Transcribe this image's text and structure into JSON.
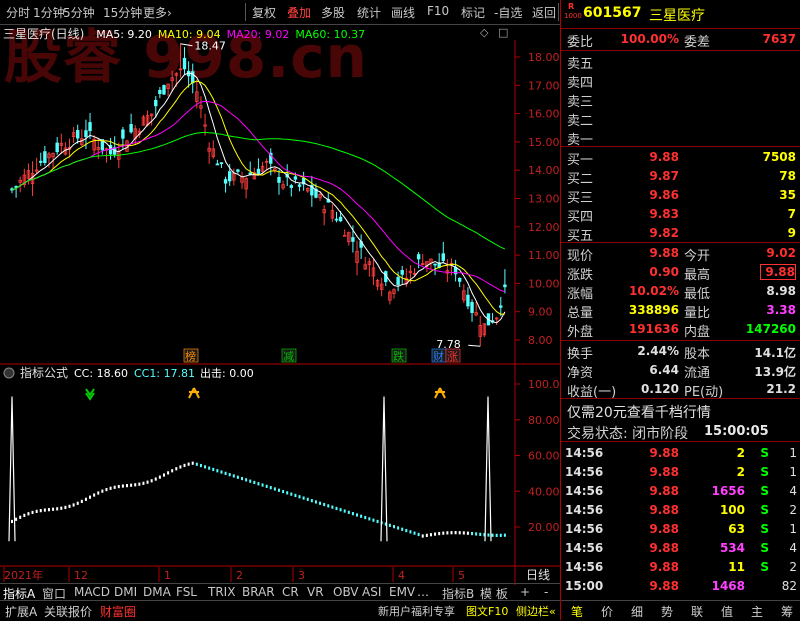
{
  "toolbar": {
    "items": [
      "分时",
      "1分钟",
      "5分钟",
      "15分钟",
      "更多›",
      "复权",
      "叠加",
      "多股",
      "统计",
      "画线",
      "F10",
      "标记",
      "-自选",
      "返回"
    ],
    "active_index": 6
  },
  "watermark": "股睿 998.cn",
  "main_chart": {
    "stock_title": "三星医疗(日线)",
    "ma_legend": [
      {
        "label": "MA5: 9.20",
        "color": "#ffffff"
      },
      {
        "label": "MA10: 9.04",
        "color": "#ffff00"
      },
      {
        "label": "MA20: 9.02",
        "color": "#ff00ff"
      },
      {
        "label": "MA60: 10.37",
        "color": "#00ff00"
      }
    ],
    "high_label": "18.47",
    "low_label": "7.78",
    "y_ticks": [
      "18.00",
      "17.00",
      "16.00",
      "15.00",
      "14.00",
      "13.00",
      "12.00",
      "11.00",
      "10.00",
      "9.00",
      "8.00"
    ],
    "badges": [
      {
        "text": "榜",
        "color": "#ff8c00"
      },
      {
        "text": "减",
        "color": "#00c000"
      },
      {
        "text": "跌",
        "color": "#00c000"
      },
      {
        "text": "财",
        "color": "#2080ff"
      },
      {
        "text": "涨",
        "color": "#ff3030"
      }
    ]
  },
  "indicator": {
    "title": "指标公式",
    "cc": "CC: 18.60",
    "cc1": "CC1: 17.81",
    "out": "出击: 0.00",
    "y_ticks": [
      "100.00",
      "80.00",
      "60.00",
      "40.00",
      "20.00"
    ]
  },
  "x_axis": {
    "labels": [
      "2021年",
      "12",
      "1",
      "2",
      "3",
      "4",
      "5"
    ],
    "right_label": "日线"
  },
  "tabs": [
    "指标A",
    "窗口",
    "MACD",
    "DMI",
    "DMA",
    "FSL",
    "TRIX",
    "BRAR",
    "CR",
    "VR",
    "OBV",
    "ASI",
    "EMV",
    "…",
    "指标B",
    "模 板",
    "+",
    "-"
  ],
  "bottom_left": [
    "扩展A",
    "关联报价",
    "财富圈"
  ],
  "bottom_right_promo": [
    "新用户福利专享",
    "图文F10",
    "侧边栏«"
  ],
  "quote": {
    "badge_top": "R",
    "badge_bottom": "1000",
    "code": "601567",
    "name": "三星医疗",
    "weibi_label": "委比",
    "weibi": "100.00%",
    "weicha_label": "委差",
    "weicha": "7637",
    "asks": [
      {
        "label": "卖五",
        "price": "",
        "vol": ""
      },
      {
        "label": "卖四",
        "price": "",
        "vol": ""
      },
      {
        "label": "卖三",
        "price": "",
        "vol": ""
      },
      {
        "label": "卖二",
        "price": "",
        "vol": ""
      },
      {
        "label": "卖一",
        "price": "",
        "vol": ""
      }
    ],
    "bids": [
      {
        "label": "买一",
        "price": "9.88",
        "vol": "7508"
      },
      {
        "label": "买二",
        "price": "9.87",
        "vol": "78"
      },
      {
        "label": "买三",
        "price": "9.86",
        "vol": "35"
      },
      {
        "label": "买四",
        "price": "9.83",
        "vol": "7"
      },
      {
        "label": "买五",
        "price": "9.82",
        "vol": "9"
      }
    ],
    "stats": [
      {
        "l1": "现价",
        "v1": "9.88",
        "c1": "#ff3030",
        "l2": "今开",
        "v2": "9.02",
        "c2": "#ff3030",
        "box2": false
      },
      {
        "l1": "涨跌",
        "v1": "0.90",
        "c1": "#ff3030",
        "l2": "最高",
        "v2": "9.88",
        "c2": "#ff3030",
        "box2": true
      },
      {
        "l1": "涨幅",
        "v1": "10.02%",
        "c1": "#ff3030",
        "l2": "最低",
        "v2": "8.98",
        "c2": "#e0e0e0",
        "box2": false
      },
      {
        "l1": "总量",
        "v1": "338896",
        "c1": "#ffff00",
        "l2": "量比",
        "v2": "3.38",
        "c2": "#ff40ff",
        "box2": false
      },
      {
        "l1": "外盘",
        "v1": "191636",
        "c1": "#ff3030",
        "l2": "内盘",
        "v2": "147260",
        "c2": "#00ff00",
        "box2": false
      }
    ],
    "fund": [
      {
        "l1": "换手",
        "v1": "2.44%",
        "l2": "股本",
        "v2": "14.1亿"
      },
      {
        "l1": "净资",
        "v1": "6.44",
        "l2": "流通",
        "v2": "13.9亿"
      },
      {
        "l1": "收益(一)",
        "v1": "0.120",
        "l2": "PE(动)",
        "v2": "21.2"
      }
    ],
    "promo": "仅需20元查看千档行情",
    "status_label": "交易状态: 闭市阶段",
    "status_time": "15:00:05",
    "ticks": [
      {
        "t": "14:56",
        "p": "9.88",
        "v": "2",
        "vc": "#ffff00",
        "s": "S",
        "n": "1"
      },
      {
        "t": "14:56",
        "p": "9.88",
        "v": "2",
        "vc": "#ffff00",
        "s": "S",
        "n": "1"
      },
      {
        "t": "14:56",
        "p": "9.88",
        "v": "1656",
        "vc": "#ff40ff",
        "s": "S",
        "n": "4"
      },
      {
        "t": "14:56",
        "p": "9.88",
        "v": "100",
        "vc": "#ffff00",
        "s": "S",
        "n": "2"
      },
      {
        "t": "14:56",
        "p": "9.88",
        "v": "63",
        "vc": "#ffff00",
        "s": "S",
        "n": "1"
      },
      {
        "t": "14:56",
        "p": "9.88",
        "v": "534",
        "vc": "#ff40ff",
        "s": "S",
        "n": "4"
      },
      {
        "t": "14:56",
        "p": "9.88",
        "v": "11",
        "vc": "#ffff00",
        "s": "S",
        "n": "2"
      },
      {
        "t": "15:00",
        "p": "9.88",
        "v": "1468",
        "vc": "#ff40ff",
        "s": "",
        "n": "82"
      }
    ],
    "bottom_tabs": [
      "笔",
      "价",
      "细",
      "势",
      "联",
      "值",
      "主",
      "筹"
    ]
  }
}
